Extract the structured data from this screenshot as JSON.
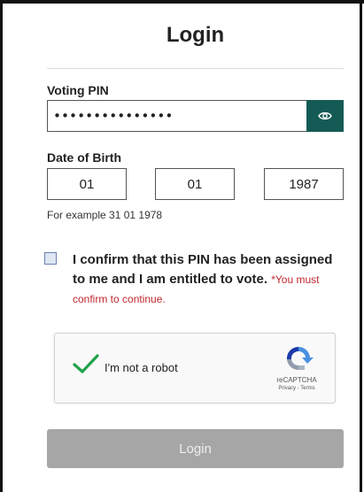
{
  "form": {
    "title": "Login",
    "pin_label": "Voting PIN",
    "pin_value": "•••••••••••••••",
    "dob_label": "Date of Birth",
    "dob_day": "01",
    "dob_month": "01",
    "dob_year": "1987",
    "dob_example": "For example 31 01 1978",
    "confirm_text": "I confirm that this PIN has been assigned to me and I am entitled to vote.",
    "confirm_error": "*You must confirm to continue.",
    "login_label": "Login"
  },
  "recaptcha": {
    "label": "I'm not a robot",
    "brand": "reCAPTCHA",
    "links": "Privacy - Terms"
  },
  "colors": {
    "accent": "#155b55",
    "error": "#c0282e",
    "button_disabled": "#a6a6a6",
    "check_green": "#1fa34a"
  },
  "icons": {
    "show_password": "eye-icon",
    "checked": "checkmark-icon",
    "recaptcha": "recaptcha-logo-icon"
  }
}
